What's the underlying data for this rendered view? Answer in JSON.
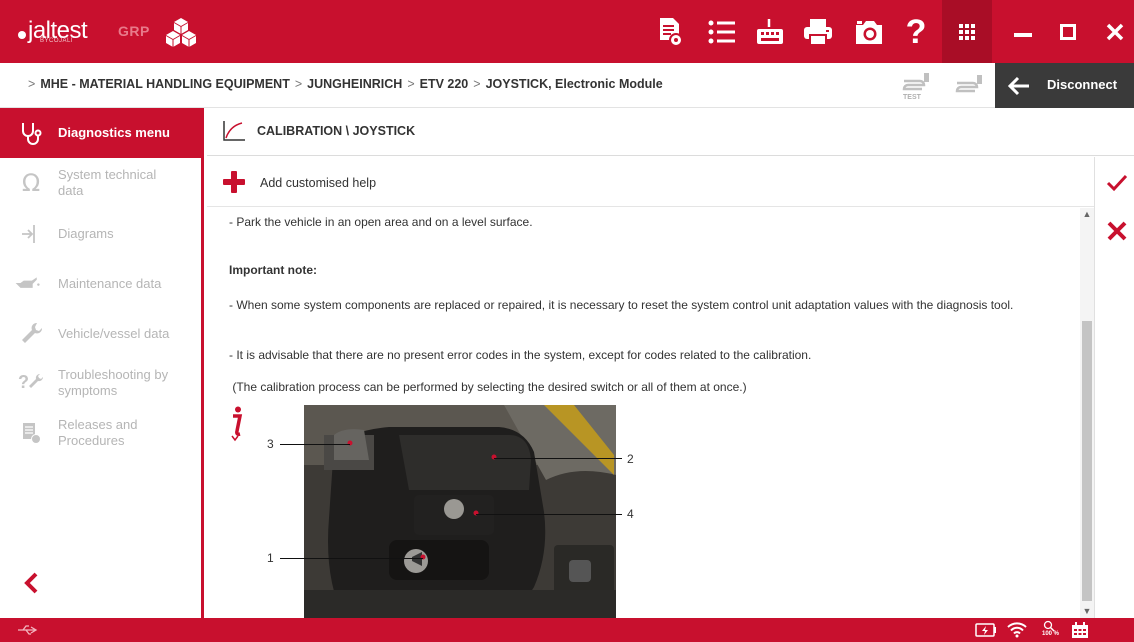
{
  "app": {
    "logo_text": "jaltest",
    "logo_sub": "BYCOJALI",
    "product": "GRP"
  },
  "toolbar": {
    "icons": [
      "report-icon",
      "list-icon",
      "keyboard-icon",
      "printer-icon",
      "camera-icon",
      "help-icon",
      "apps-grid-icon"
    ],
    "window": [
      "minimize-icon",
      "maximize-icon",
      "close-icon"
    ]
  },
  "breadcrumb": {
    "items": [
      "MHE - MATERIAL HANDLING EQUIPMENT",
      "JUNGHEINRICH",
      "ETV 220",
      "JOYSTICK, Electronic Module"
    ],
    "test_label": "TEST",
    "disconnect_label": "Disconnect"
  },
  "sidebar": {
    "items": [
      {
        "label": "Diagnostics menu",
        "icon": "stethoscope-icon",
        "active": true
      },
      {
        "label": "System technical data",
        "icon": "omega-icon"
      },
      {
        "label": "Diagrams",
        "icon": "diagram-icon"
      },
      {
        "label": "Maintenance data",
        "icon": "oil-can-icon"
      },
      {
        "label": "Vehicle/vessel data",
        "icon": "wrench-icon"
      },
      {
        "label": "Troubleshooting by symptoms",
        "icon": "troubleshooting-icon"
      },
      {
        "label": "Releases and Procedures",
        "icon": "document-icon"
      }
    ]
  },
  "content": {
    "title": "CALIBRATION \\ JOYSTICK",
    "add_help_label": "Add customised help",
    "paragraphs": [
      "- Park the vehicle in an open area and on a level surface.",
      "Important note:",
      "- When some system components are replaced or repaired, it is necessary to reset the system control unit adaptation values with the diagnosis tool.",
      "- It is advisable that there are no present error codes in the system, except for codes related to the calibration.",
      " (The calibration process can be performed by selecting the desired switch or all of them at once.)"
    ],
    "callouts": [
      "3",
      "2",
      "4",
      "1"
    ]
  },
  "status": {
    "zoom": "100 %"
  },
  "colors": {
    "brand": "#c8102e",
    "dark": "#3a3a3a"
  }
}
